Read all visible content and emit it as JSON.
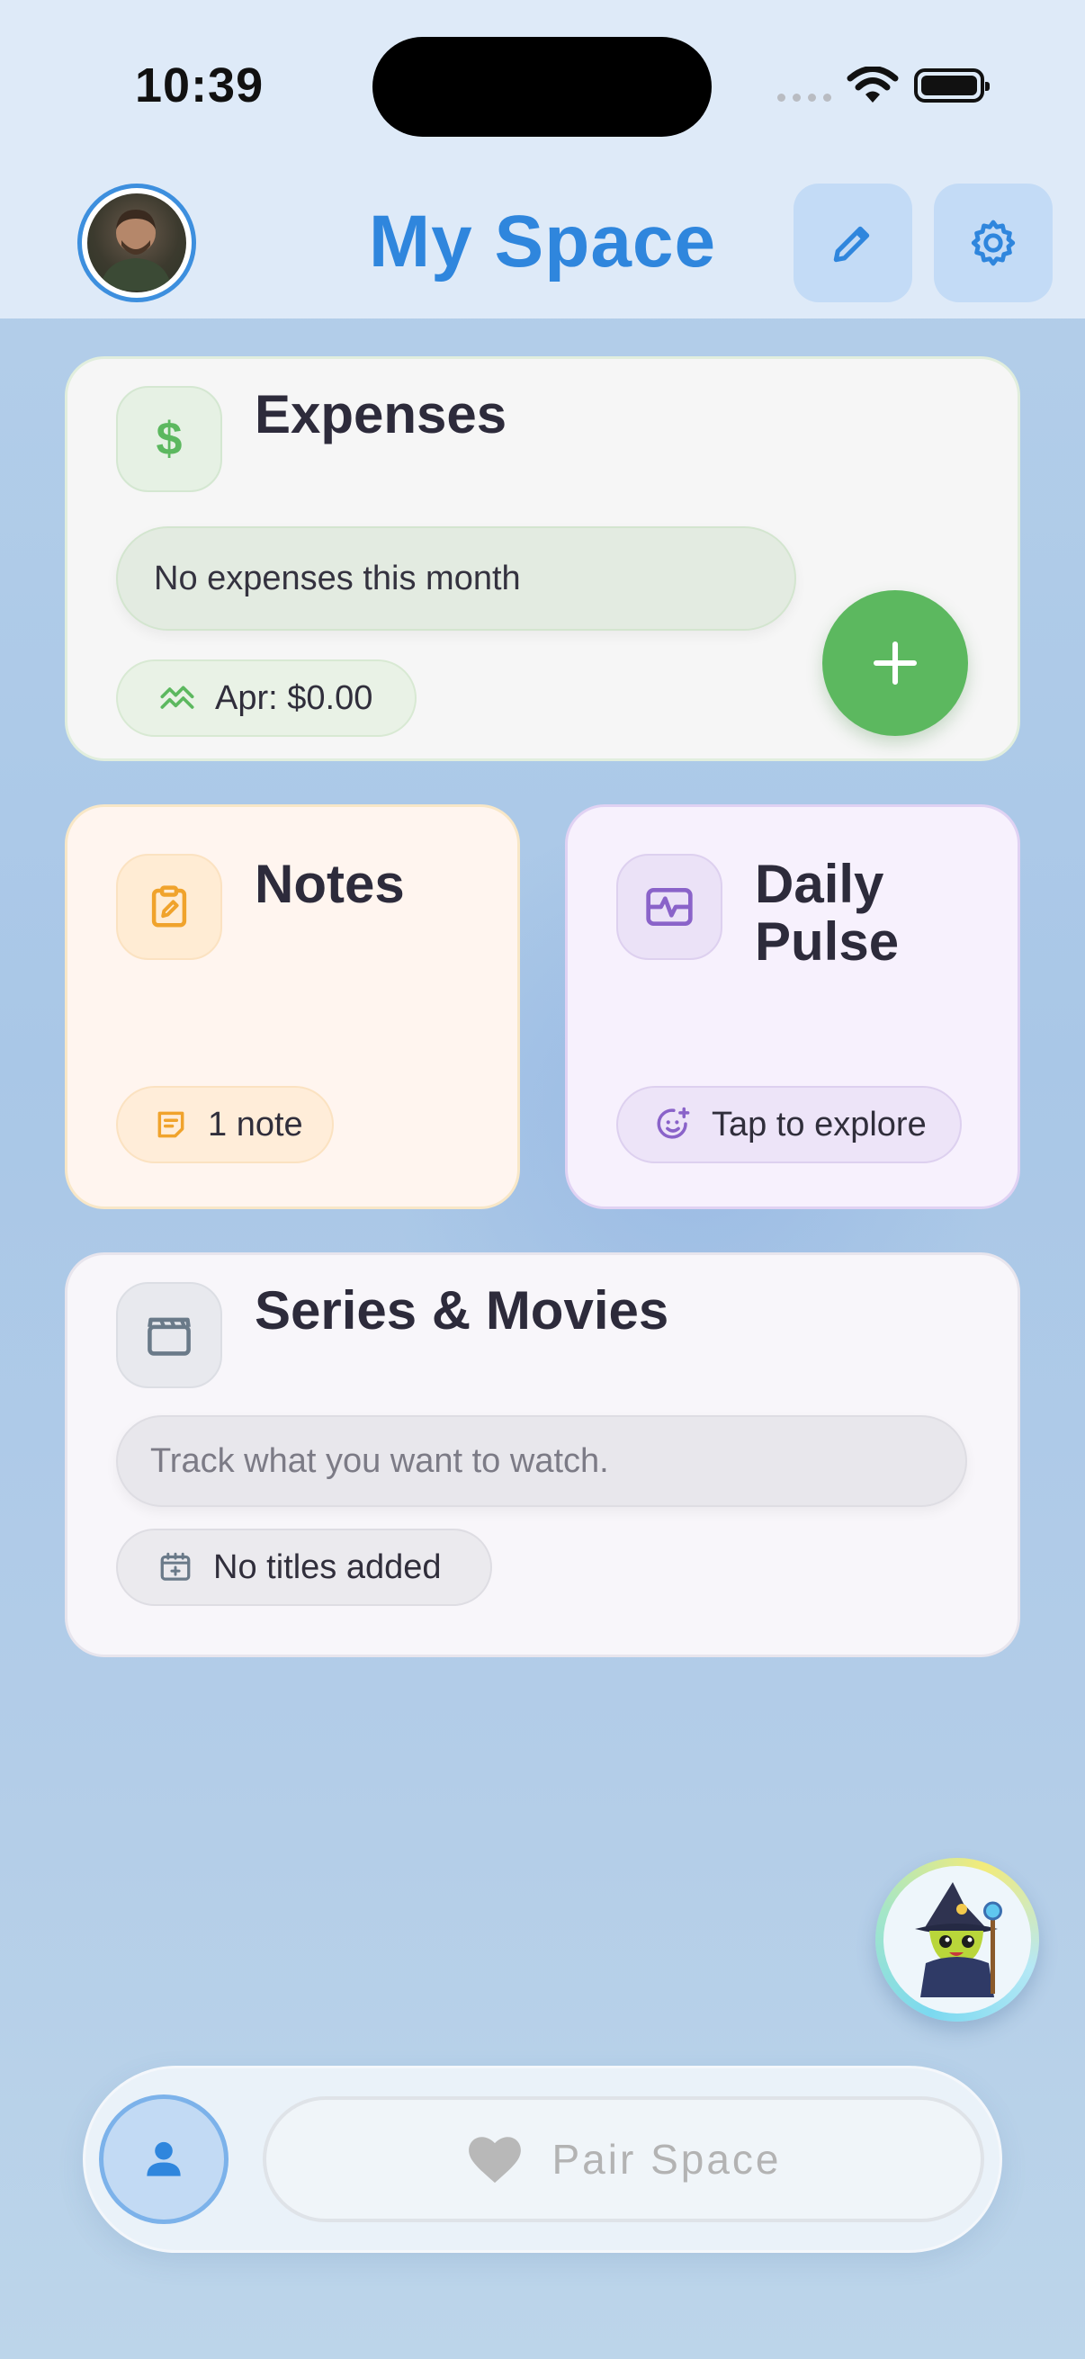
{
  "status_bar": {
    "time": "10:39"
  },
  "header": {
    "title": "My Space"
  },
  "cards": {
    "expenses": {
      "title": "Expenses",
      "icon_symbol": "$",
      "empty_text": "No expenses this month",
      "summary": "Apr: $0.00",
      "accent": "#5cb85f"
    },
    "notes": {
      "title": "Notes",
      "count": "1 note",
      "accent": "#f0a32c"
    },
    "daily_pulse": {
      "title": "Daily Pulse",
      "action": "Tap to explore",
      "accent": "#8a63c9"
    },
    "series": {
      "title": "Series & Movies",
      "placeholder": "Track what you want to watch.",
      "status": "No titles added",
      "accent": "#6a7a89"
    }
  },
  "bottom_bar": {
    "pair_label": "Pair Space"
  },
  "icons": [
    "pencil-icon",
    "gear-icon",
    "dollar-icon",
    "plus-icon",
    "trend-icon",
    "clipboard-edit-icon",
    "note-icon",
    "pulse-icon",
    "smile-plus-icon",
    "clapperboard-icon",
    "calendar-plus-icon",
    "person-icon",
    "heart-icon"
  ],
  "colors": {
    "primary": "#2f86dd",
    "header_bg": "#deeaf8"
  }
}
